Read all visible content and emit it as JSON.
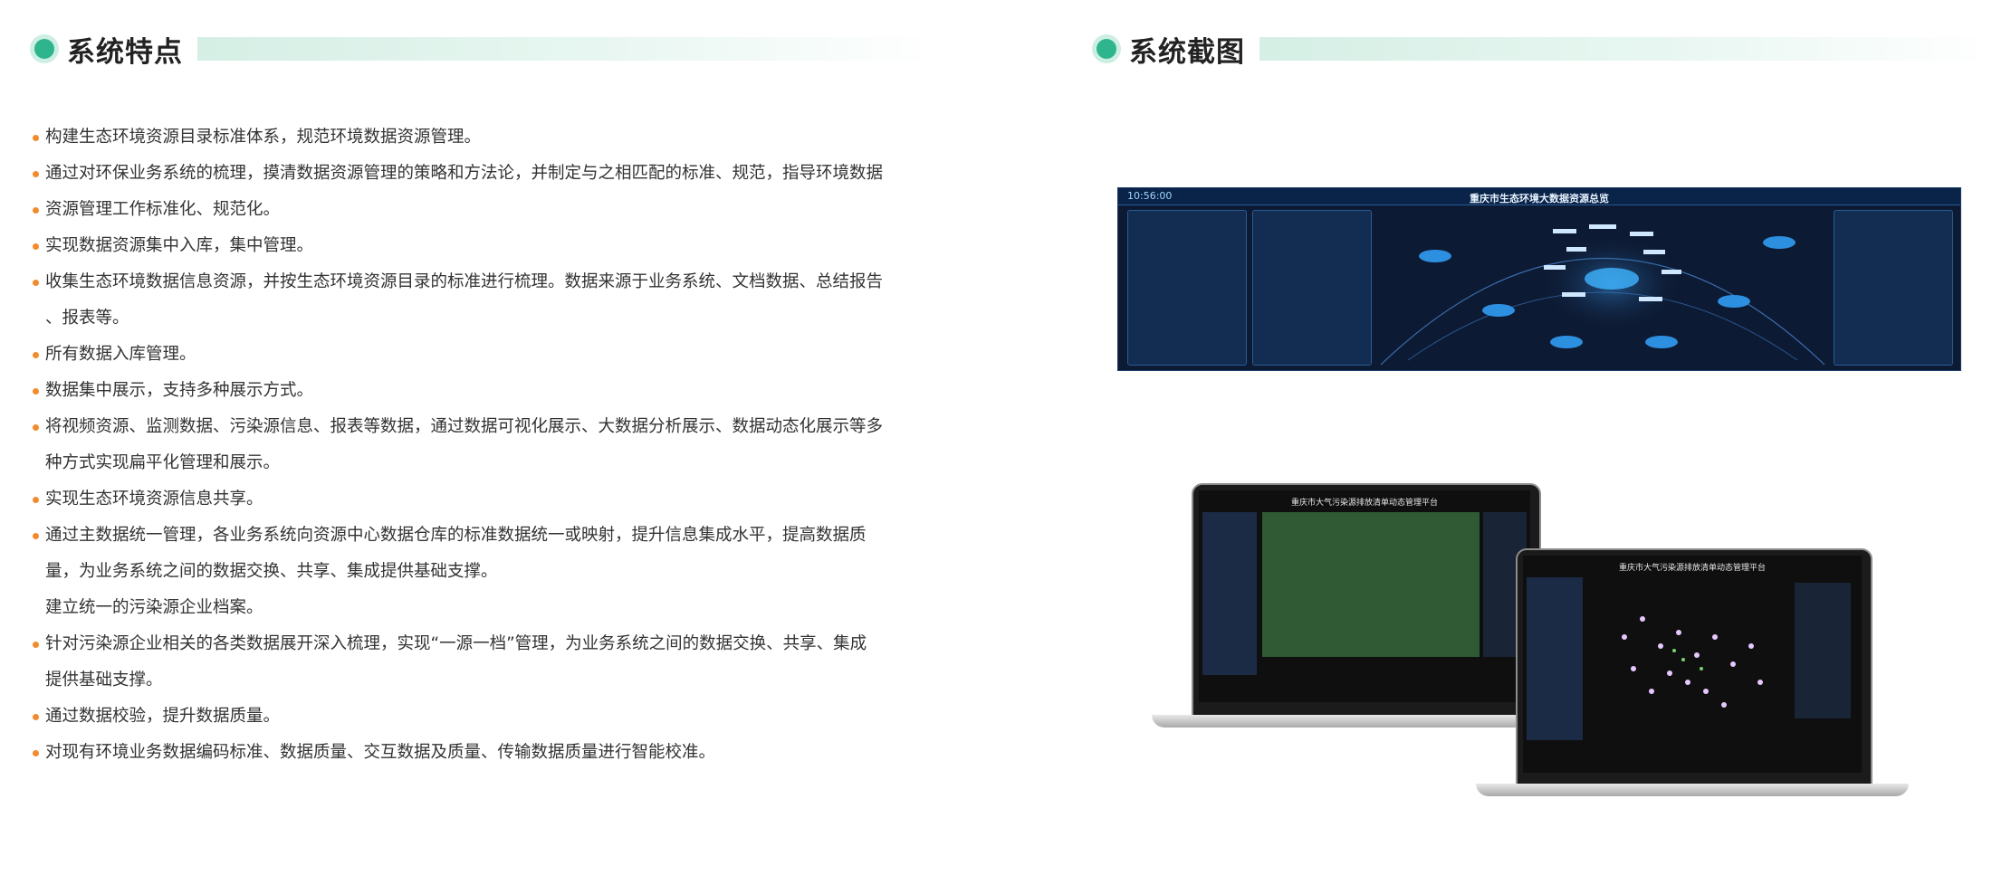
{
  "left_section": {
    "title": "系统特点",
    "items": [
      {
        "text": "构建生态环境资源目录标准体系，规范环境数据资源管理。",
        "bullet": true
      },
      {
        "text": "通过对环保业务系统的梳理，摸清数据资源管理的策略和方法论，并制定与之相匹配的标准、规范，指导环境数据",
        "bullet": true
      },
      {
        "text": "资源管理工作标准化、规范化。",
        "bullet": true
      },
      {
        "text": "实现数据资源集中入库，集中管理。",
        "bullet": true
      },
      {
        "text": "收集生态环境数据信息资源，并按生态环境资源目录的标准进行梳理。数据来源于业务系统、文档数据、总结报告",
        "bullet": true
      },
      {
        "text": "、报表等。",
        "bullet": false
      },
      {
        "text": "所有数据入库管理。",
        "bullet": true
      },
      {
        "text": "数据集中展示，支持多种展示方式。",
        "bullet": true
      },
      {
        "text": "将视频资源、监测数据、污染源信息、报表等数据，通过数据可视化展示、大数据分析展示、数据动态化展示等多",
        "bullet": true
      },
      {
        "text": "种方式实现扁平化管理和展示。",
        "bullet": false
      },
      {
        "text": "实现生态环境资源信息共享。",
        "bullet": true
      },
      {
        "text": "通过主数据统一管理，各业务系统向资源中心数据仓库的标准数据统一或映射，提升信息集成水平，提高数据质",
        "bullet": true
      },
      {
        "text": "量，为业务系统之间的数据交换、共享、集成提供基础支撑。",
        "bullet": false
      },
      {
        "text": "建立统一的污染源企业档案。",
        "bullet": false
      },
      {
        "text": "针对污染源企业相关的各类数据展开深入梳理，实现“一源一档”管理，为业务系统之间的数据交换、共享、集成",
        "bullet": true
      },
      {
        "text": "提供基础支撑。",
        "bullet": false
      },
      {
        "text": "通过数据校验，提升数据质量。",
        "bullet": true
      },
      {
        "text": "对现有环境业务数据编码标准、数据质量、交互数据及质量、传输数据质量进行智能校准。",
        "bullet": true
      }
    ]
  },
  "right_section": {
    "title": "系统截图",
    "dashboard": {
      "time": "10:56:00",
      "title": "重庆市生态环境大数据资源总览"
    },
    "laptop_1": {
      "title": "重庆市大气污染源排放清单动态管理平台"
    },
    "laptop_2": {
      "title": "重庆市大气污染源排放清单动态管理平台"
    }
  },
  "colors": {
    "accent": "#2eb58d",
    "bullet": "#f28b2e"
  }
}
